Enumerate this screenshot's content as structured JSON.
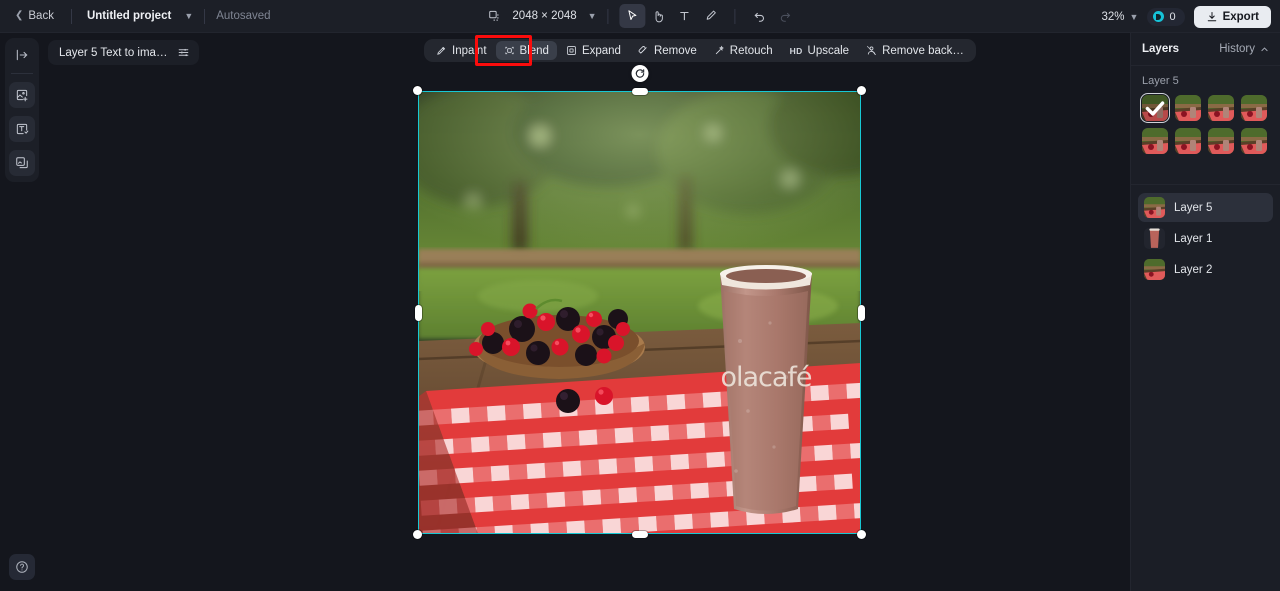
{
  "topbar": {
    "back_label": "Back",
    "project_name": "Untitled project",
    "autosaved_label": "Autosaved",
    "canvas_size": "2048 × 2048",
    "zoom_level": "32%",
    "credits_count": "0",
    "export_label": "Export",
    "tools": [
      {
        "name": "crop-resize-icon",
        "label": "Resize canvas",
        "active": false
      },
      {
        "name": "select-tool-icon",
        "label": "Select",
        "active": true
      },
      {
        "name": "hand-tool-icon",
        "label": "Pan",
        "active": false
      },
      {
        "name": "text-tool-icon",
        "label": "Text",
        "active": false
      },
      {
        "name": "brush-tool-icon",
        "label": "Brush",
        "active": false
      },
      {
        "name": "undo-icon",
        "label": "Undo",
        "active": false
      },
      {
        "name": "redo-icon",
        "label": "Redo",
        "active": false
      }
    ]
  },
  "left_rail": {
    "collapse_label": "Collapse panel",
    "tools": [
      {
        "name": "add-image-icon",
        "label": "Add image"
      },
      {
        "name": "text-to-image-icon",
        "label": "Text to image"
      },
      {
        "name": "layers-icon",
        "label": "Layers"
      }
    ],
    "help_label": "Help"
  },
  "layer_chip": {
    "text": "Layer 5 Text to ima…",
    "settings_icon": "sliders-icon"
  },
  "action_bar": {
    "items": [
      {
        "label": "Inpaint",
        "icon": "inpaint-icon",
        "active": false
      },
      {
        "label": "Blend",
        "icon": "blend-icon",
        "active": true
      },
      {
        "label": "Expand",
        "icon": "expand-icon",
        "active": false
      },
      {
        "label": "Remove",
        "icon": "remove-icon",
        "active": false
      },
      {
        "label": "Retouch",
        "icon": "retouch-icon",
        "active": false
      },
      {
        "label": "Upscale",
        "icon": "hd-icon",
        "badge": "HD",
        "active": false
      },
      {
        "label": "Remove back…",
        "icon": "remove-background-icon",
        "active": false
      }
    ],
    "highlighted_item": "Blend",
    "highlight_color": "#fb0c0c"
  },
  "canvas": {
    "selection_border_color": "#17c8d4",
    "rotate_handle": "rotate-icon",
    "image_alt": "Smoothie cup branded olacafé beside a wooden bowl of blackberries and red currants on a red gingham picnic cloth",
    "brand_text": "olacafé"
  },
  "right_panel": {
    "title": "Layers",
    "history_label": "History",
    "history_caret": "chevron-up-icon",
    "variants_group_label": "Layer 5",
    "variants_count": 8,
    "selected_variant_index": 0,
    "layers": [
      {
        "name": "Layer 5",
        "selected": true,
        "thumb": "scene"
      },
      {
        "name": "Layer 1",
        "selected": false,
        "thumb": "cup"
      },
      {
        "name": "Layer 2",
        "selected": false,
        "thumb": "scene"
      }
    ]
  }
}
